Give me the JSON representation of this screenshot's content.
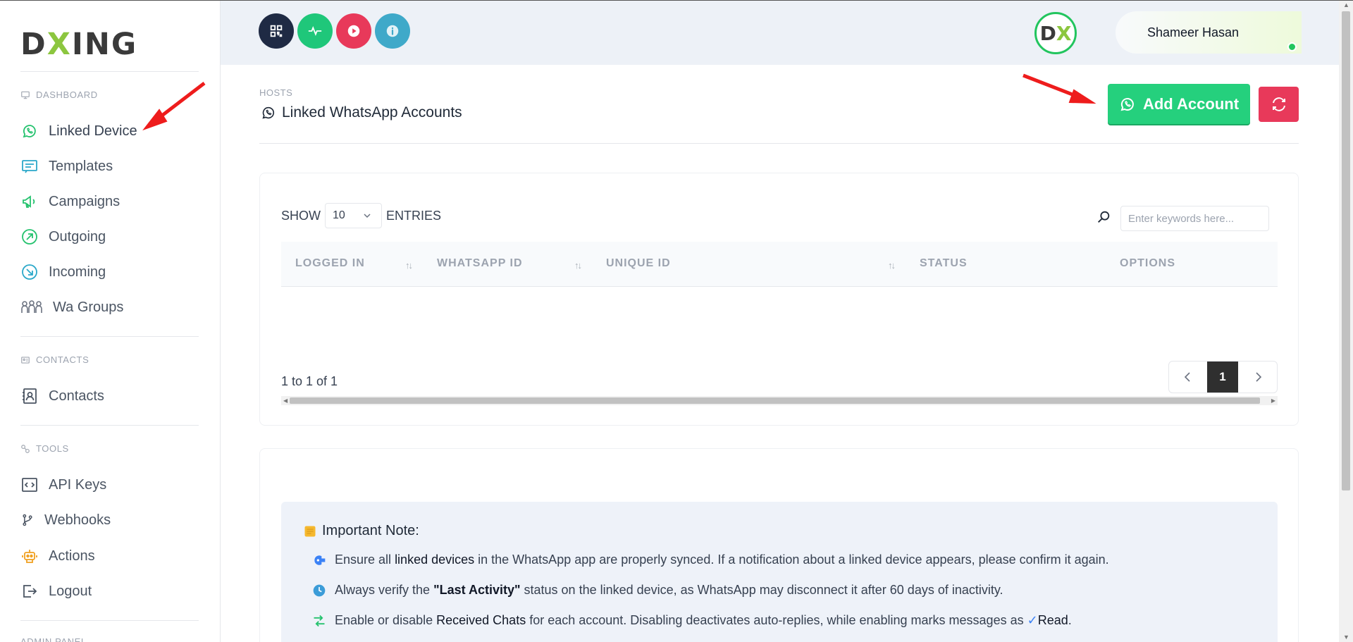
{
  "brand": {
    "logo_pre": "D",
    "logo_x": "X",
    "logo_post": "ING"
  },
  "sidebar": {
    "sections": [
      {
        "label": "DASHBOARD"
      },
      {
        "label": "CONTACTS"
      },
      {
        "label": "TOOLS"
      },
      {
        "label": "ADMIN PANEL"
      }
    ],
    "items": [
      {
        "label": "Linked Device",
        "icon": "whatsapp-icon"
      },
      {
        "label": "Templates",
        "icon": "templates-icon"
      },
      {
        "label": "Campaigns",
        "icon": "megaphone-icon"
      },
      {
        "label": "Outgoing",
        "icon": "arrow-up-right-icon"
      },
      {
        "label": "Incoming",
        "icon": "arrow-down-right-icon"
      },
      {
        "label": "Wa Groups",
        "icon": "users-icon"
      },
      {
        "label": "Contacts",
        "icon": "contact-book-icon"
      },
      {
        "label": "API Keys",
        "icon": "code-icon"
      },
      {
        "label": "Webhooks",
        "icon": "git-branch-icon"
      },
      {
        "label": "Actions",
        "icon": "robot-icon"
      },
      {
        "label": "Logout",
        "icon": "logout-icon"
      }
    ]
  },
  "header": {
    "user_name": "Shameer Hasan",
    "avatar_pre": "D",
    "avatar_x": "X",
    "quick_icons": [
      {
        "name": "qr-code-icon",
        "color": "#1f2a44"
      },
      {
        "name": "activity-icon",
        "color": "#1fc77a"
      },
      {
        "name": "play-icon",
        "color": "#e8395a"
      },
      {
        "name": "info-icon",
        "color": "#3fa9c9"
      }
    ]
  },
  "page": {
    "breadcrumb": "HOSTS",
    "title": "Linked WhatsApp Accounts",
    "add_button": "Add Account"
  },
  "table": {
    "show_label": "SHOW",
    "page_size": "10",
    "entries_label": "ENTRIES",
    "search_placeholder": "Enter keywords here...",
    "columns": [
      "LOGGED IN",
      "WHATSAPP ID",
      "UNIQUE ID",
      "STATUS",
      "OPTIONS"
    ],
    "info": "1 to 1 of 1",
    "current_page": "1"
  },
  "note": {
    "title": "Important Note:",
    "line1_a": "Ensure all",
    "line1_b": "linked devices",
    "line1_c": "in the WhatsApp app are properly synced. If a notification about a linked device appears, please confirm it again.",
    "line2_a": "Always verify the",
    "line2_b": "\"Last Activity\"",
    "line2_c": "status on the linked device, as WhatsApp may disconnect it after 60 days of inactivity.",
    "line3_a": "Enable or disable",
    "line3_b": "Received Chats",
    "line3_c": "for each account. Disabling deactivates auto-replies, while enabling marks messages as",
    "line3_d": "Read"
  },
  "colors": {
    "accent_green": "#25d07d",
    "danger_red": "#e8395a",
    "annotation_red": "#ee1c1c"
  }
}
